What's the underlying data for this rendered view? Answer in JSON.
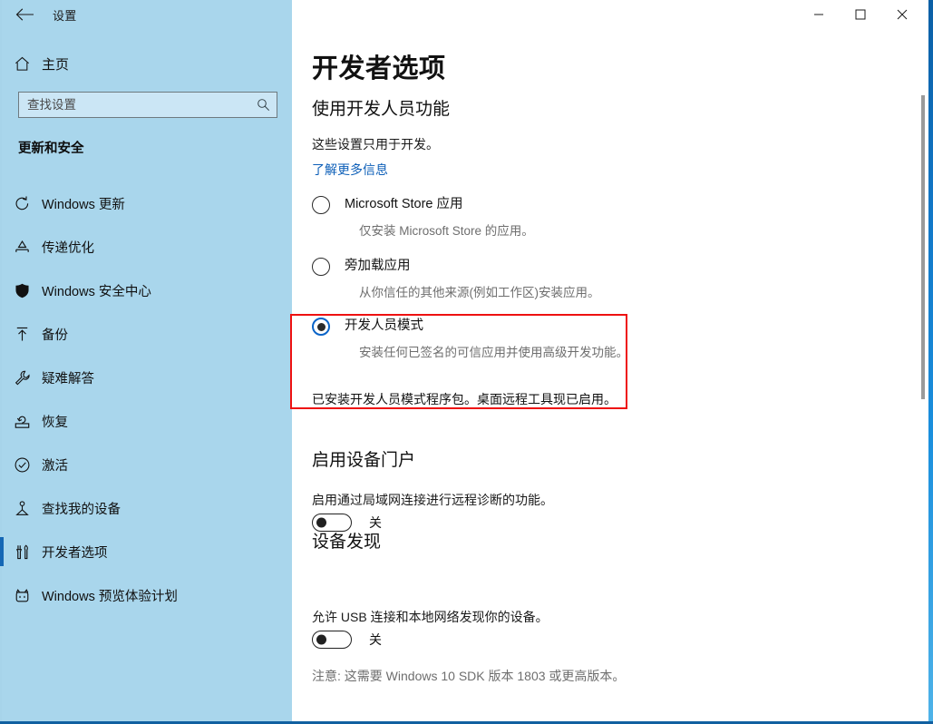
{
  "window": {
    "app_title": "设置",
    "back_icon": "back-arrow-icon",
    "minimize_label": "最小化",
    "maximize_label": "最大化",
    "close_label": "关闭",
    "accent_color": "#1278c8"
  },
  "sidebar": {
    "home": {
      "icon": "home-icon",
      "label": "主页"
    },
    "search": {
      "placeholder": "查找设置",
      "value": "",
      "icon": "search-icon"
    },
    "group_title": "更新和安全",
    "items": [
      {
        "label": "Windows 更新",
        "icon": "refresh-icon",
        "selected": false
      },
      {
        "label": "传递优化",
        "icon": "delivery-optimization-icon",
        "selected": false
      },
      {
        "label": "Windows 安全中心",
        "icon": "shield-icon",
        "selected": false
      },
      {
        "label": "备份",
        "icon": "upload-arrow-icon",
        "selected": false
      },
      {
        "label": "疑难解答",
        "icon": "wrench-icon",
        "selected": false
      },
      {
        "label": "恢复",
        "icon": "recovery-icon",
        "selected": false
      },
      {
        "label": "激活",
        "icon": "check-circle-icon",
        "selected": false
      },
      {
        "label": "查找我的设备",
        "icon": "find-my-device-icon",
        "selected": false
      },
      {
        "label": "开发者选项",
        "icon": "developer-tools-icon",
        "selected": true
      },
      {
        "label": "Windows 预览体验计划",
        "icon": "insider-program-icon",
        "selected": false
      }
    ],
    "background_color": "#a9d6ec",
    "selected_indicator_color": "#1567b5"
  },
  "main": {
    "page_title": "开发者选项",
    "use_dev_features": {
      "heading": "使用开发人员功能",
      "description": "这些设置只用于开发。",
      "learn_more": "了解更多信息",
      "learn_more_color": "#0d5fb8",
      "options": [
        {
          "label": "Microsoft Store 应用",
          "description": "仅安装 Microsoft Store 的应用。",
          "selected": false
        },
        {
          "label": "旁加载应用",
          "description": "从你信任的其他来源(例如工作区)安装应用。",
          "selected": false
        },
        {
          "label": "开发人员模式",
          "description": "安装任何已签名的可信应用并使用高级开发功能。",
          "selected": true
        }
      ],
      "dev_installed_note": "已安装开发人员模式程序包。桌面远程工具现已启用。",
      "highlight_border_color": "#ee1111"
    },
    "device_portal": {
      "heading": "启用设备门户",
      "description": "启用通过局域网连接进行远程诊断的功能。",
      "toggle_state": "关",
      "toggle_on": false
    },
    "device_discovery": {
      "heading": "设备发现",
      "description": "允许 USB 连接和本地网络发现你的设备。",
      "toggle_state": "关",
      "toggle_on": false,
      "note": "注意: 这需要 Windows 10 SDK 版本 1803 或更高版本。"
    }
  }
}
